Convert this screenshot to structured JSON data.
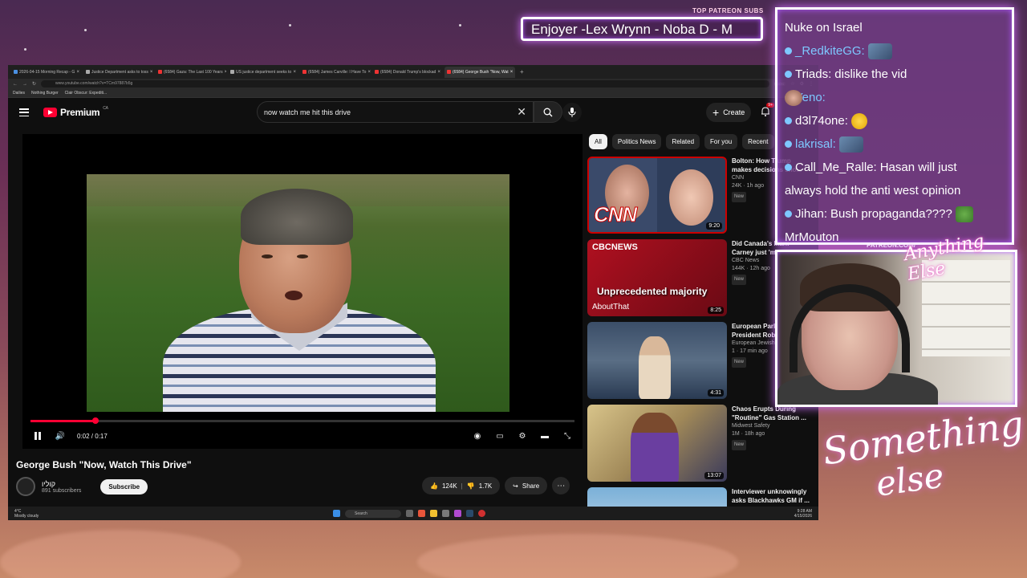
{
  "browser": {
    "tabs": [
      {
        "label": "2026-04-15 Morning Recap - G",
        "fav": "g"
      },
      {
        "label": "Justice Department asks to toss",
        "fav": "w"
      },
      {
        "label": "(6584) Gaza: The Last 100 Years",
        "fav": "r"
      },
      {
        "label": "US justice department seeks to",
        "fav": "w"
      },
      {
        "label": "(6584) James Carville: I Have To",
        "fav": "r"
      },
      {
        "label": "(6584) Donald Trump's blockad",
        "fav": "r"
      },
      {
        "label": "(6584) George Bush \"Now, Wat",
        "fav": "r",
        "active": true
      }
    ],
    "url": "www.youtube.com/watch?v=TCm97887b5g",
    "zoom": "160%",
    "bookmarks": [
      "Dailies",
      "Nothing Burger",
      "Clair Obscur: Expediti..."
    ]
  },
  "yt": {
    "logo": "Premium",
    "country": "CA",
    "search_query": "now watch me hit this drive",
    "create_label": "Create",
    "notif_count": "9+"
  },
  "player": {
    "time": "0:02 / 0:17",
    "progress": 0.12
  },
  "video": {
    "title": "George Bush \"Now, Watch This Drive\"",
    "channel": "קוליו",
    "subs": "891 subscribers",
    "subscribe": "Subscribe",
    "likes": "124K",
    "dislikes": "1.7K",
    "share": "Share"
  },
  "chips": [
    "All",
    "Politics News",
    "Related",
    "For you",
    "Recent"
  ],
  "recs": [
    {
      "title": "Bolton: How Trump makes decisions sho...",
      "channel": "CNN",
      "meta": "24K · 1h ago",
      "badge": "New",
      "duration": "9:20"
    },
    {
      "title": "Did Canada's Mark Carney just 'm...",
      "channel": "CBC News",
      "meta": "144K · 12h ago",
      "badge": "New",
      "duration": "8:25",
      "caption": "Unprecedented majority",
      "about": "AboutThat",
      "logo": "CBCNEWS"
    },
    {
      "title": "European Parliament President Rob...",
      "channel": "European Jewish",
      "meta": "1 · 17 min ago",
      "badge": "New",
      "duration": "4:31"
    },
    {
      "title": "Chaos Erupts During \"Routine\" Gas Station ...",
      "channel": "Midwest Safety",
      "meta": "1M · 18h ago",
      "badge": "New",
      "duration": "13:07"
    },
    {
      "title": "Interviewer unknowingly asks Blackhawks GM if ...",
      "channel": "",
      "meta": "",
      "badge": "",
      "duration": ""
    }
  ],
  "taskbar": {
    "weather_temp": "4°C",
    "weather_desc": "Mostly cloudy",
    "search": "Search",
    "time": "9:28 AM",
    "date": "4/15/2026"
  },
  "overlay": {
    "sub_header": "TOP PATREON SUBS",
    "sub_banner": "Enjoyer -Lex Wrynn -  Noba D - M",
    "patreon_url": "PATREON.COM/",
    "anything_else": "Anything Else",
    "something_1": "Something",
    "something_2": "else"
  },
  "chat": [
    {
      "user": "",
      "text": "Nuke on Israel",
      "emote": ""
    },
    {
      "user": "_RedkiteGG:",
      "text": "",
      "emote": "blob"
    },
    {
      "user": "Triads:",
      "text": "dislike the vid",
      "emote": "",
      "white_user": true
    },
    {
      "user": "Yeno:",
      "text": "",
      "emote": "face"
    },
    {
      "user": "d3l74one:",
      "text": "",
      "emote": "duck",
      "white_user": true
    },
    {
      "user": "lakrisal:",
      "text": "",
      "emote": "blob"
    },
    {
      "user": "Call_Me_Ralle:",
      "text": "Hasan will just",
      "emote": "",
      "white_user": true
    },
    {
      "user": "",
      "text": "always hold the anti west opinion",
      "emote": ""
    },
    {
      "user": "Jihan:",
      "text": "Bush propaganda????",
      "emote": "frog",
      "white_user": true
    },
    {
      "user": "",
      "text": "MrMouton",
      "emote": ""
    }
  ]
}
